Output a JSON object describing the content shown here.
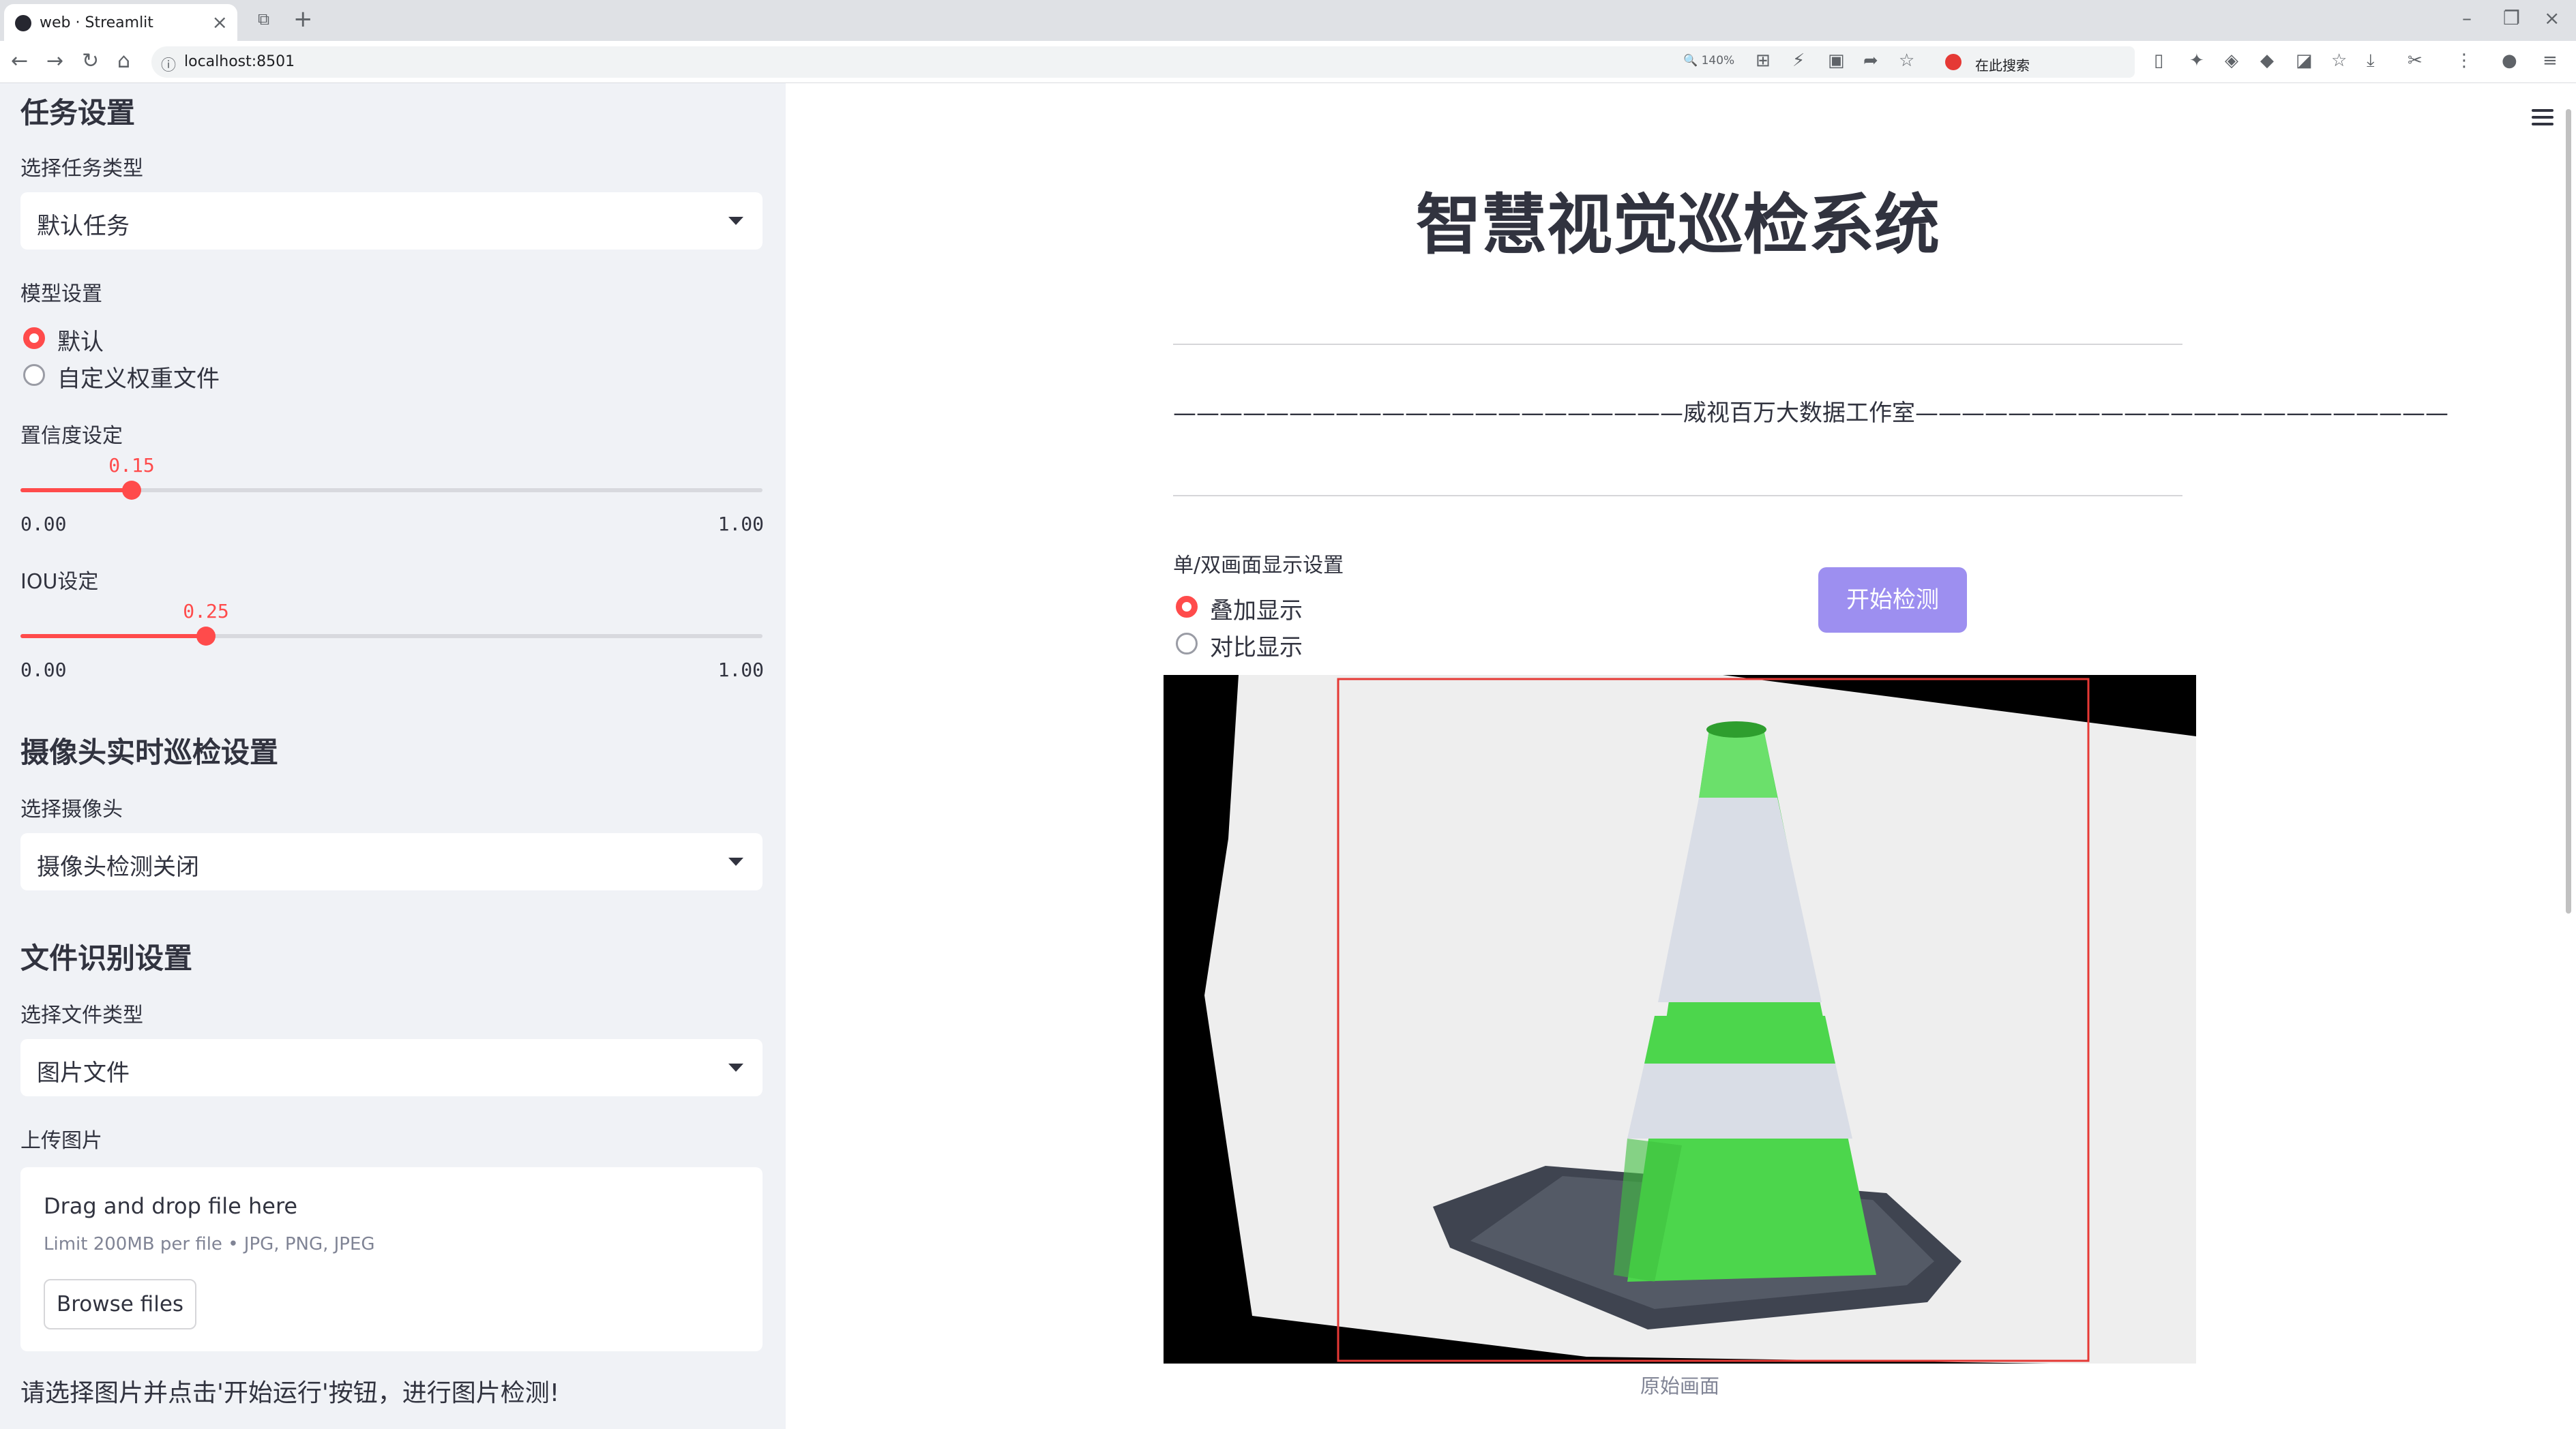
{
  "browser": {
    "tab_title": "web · Streamlit",
    "url": "localhost:8501",
    "zoom": "140%",
    "search_text": "在此搜索"
  },
  "sidebar": {
    "task_heading": "任务设置",
    "task_type_label": "选择任务类型",
    "task_type_value": "默认任务",
    "model_label": "模型设置",
    "model_options": [
      "默认",
      "自定义权重文件"
    ],
    "model_selected": "默认",
    "confidence": {
      "label": "置信度设定",
      "value": 0.15,
      "value_text": "0.15",
      "min": "0.00",
      "max": "1.00"
    },
    "iou": {
      "label": "IOU设定",
      "value": 0.25,
      "value_text": "0.25",
      "min": "0.00",
      "max": "1.00"
    },
    "camera_heading": "摄像头实时巡检设置",
    "camera_label": "选择摄像头",
    "camera_value": "摄像头检测关闭",
    "file_heading": "文件识别设置",
    "file_type_label": "选择文件类型",
    "file_type_value": "图片文件",
    "upload_label": "上传图片",
    "upload": {
      "title": "Drag and drop file here",
      "limit": "Limit 200MB per file • JPG, PNG, JPEG",
      "button": "Browse files"
    },
    "note": "请选择图片并点击'开始运行'按钮，进行图片检测!"
  },
  "main": {
    "title": "智慧视觉巡检系统",
    "studio_line": "——————————————————————威视百万大数据工作室———————————————————————",
    "display_label": "单/双画面显示设置",
    "display_options": [
      "叠加显示",
      "对比显示"
    ],
    "display_selected": "叠加显示",
    "start_button": "开始检测",
    "image_caption": "原始画面",
    "colors": {
      "accent": "#ff4b4b",
      "button": "#9d8ff0",
      "cone": "#4cd64c",
      "box": "#e53935"
    }
  }
}
